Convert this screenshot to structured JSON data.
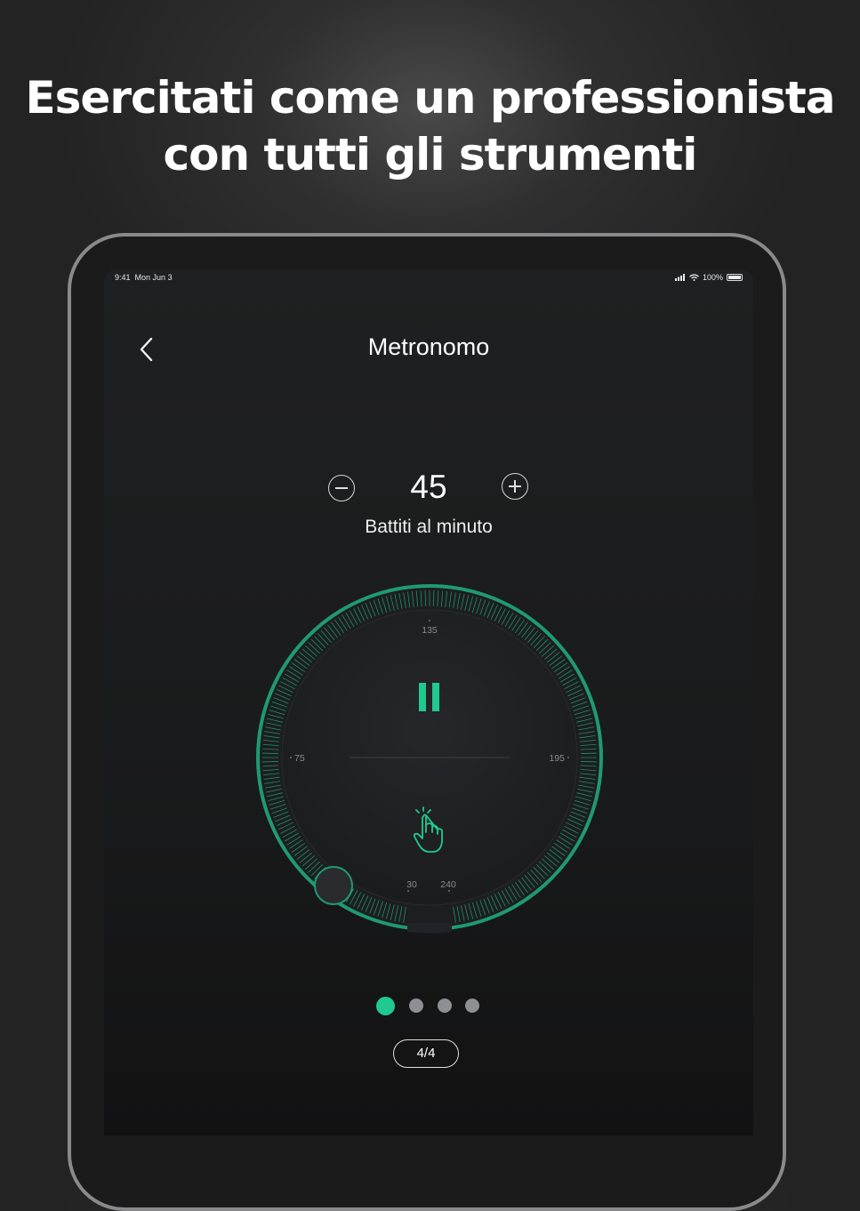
{
  "headline": {
    "line1": "Esercitati come un professionista",
    "line2": "con tutti gli strumenti"
  },
  "status_bar": {
    "time": "9:41",
    "date": "Mon Jun 3",
    "battery": "100%"
  },
  "nav": {
    "title": "Metronomo",
    "back_icon": "chevron-left-icon"
  },
  "tempo": {
    "bpm": "45",
    "label": "Battiti al minuto",
    "decrease_icon": "minus-circle-icon",
    "increase_icon": "plus-circle-icon"
  },
  "dial": {
    "labels": {
      "top": "135",
      "left": "75",
      "right": "195",
      "bottom_left": "30",
      "bottom_right": "240"
    },
    "state_icon": "pause-icon",
    "hint_icon": "tap-hand-icon",
    "knob_value": "45"
  },
  "pager": {
    "count": 4,
    "active": 0
  },
  "time_signature": "4/4",
  "colors": {
    "accent": "#20c98f",
    "background": "#1a1b1c",
    "inactive_dot": "#8e8f93"
  }
}
